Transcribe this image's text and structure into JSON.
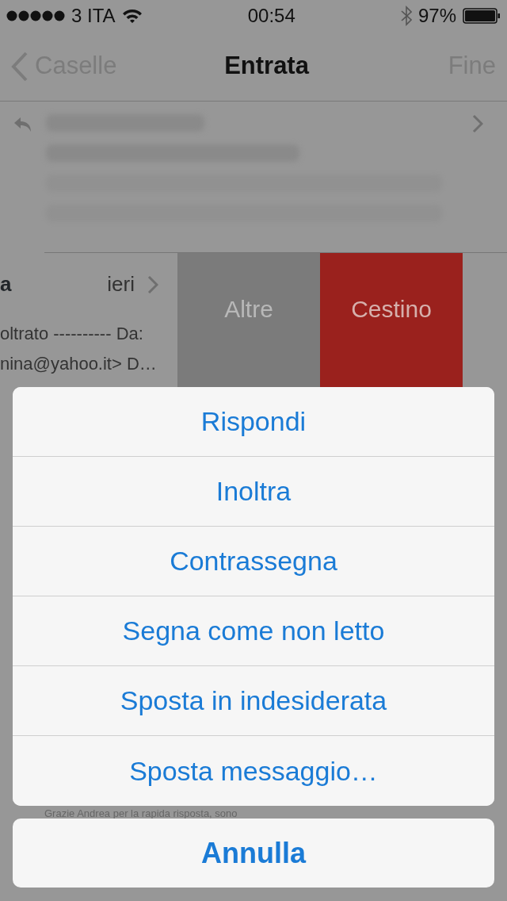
{
  "status_bar": {
    "carrier": "3 ITA",
    "time": "00:54",
    "battery": "97%"
  },
  "nav": {
    "back": "Caselle",
    "title": "Entrata",
    "action": "Fine"
  },
  "messages": [
    {
      "kind": "blurred",
      "replied": true
    },
    {
      "kind": "swiped",
      "sender": "a",
      "date": "ieri",
      "preview": [
        "oltrato ---------- Da:",
        "nina@yahoo.it> D…"
      ],
      "actions": [
        {
          "label": "Altre",
          "kind": "more"
        },
        {
          "label": "Cestino",
          "kind": "trash"
        }
      ]
    }
  ],
  "background_text": "Grazie Andrea per la rapida risposta, sono",
  "action_sheet": {
    "items": [
      "Rispondi",
      "Inoltra",
      "Contrassegna",
      "Segna come non letto",
      "Sposta in indesiderata",
      "Sposta messaggio…"
    ],
    "cancel": "Annulla"
  }
}
